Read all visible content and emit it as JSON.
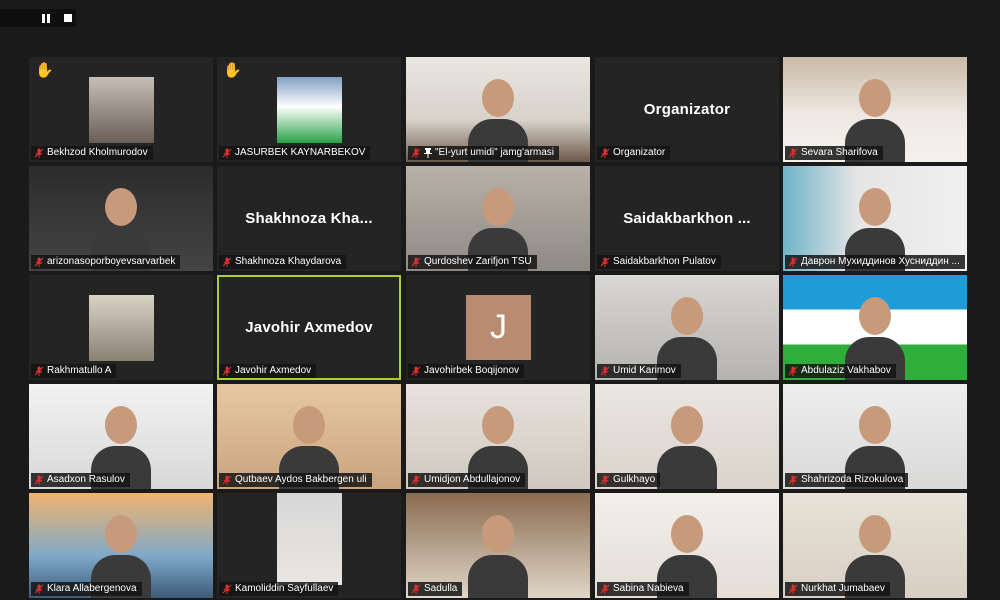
{
  "toolbar": {
    "pause_icon": "pause-icon",
    "stop_icon": "stop-icon"
  },
  "colors": {
    "background": "#1a1a1a",
    "tile": "#242424",
    "active_border": "#a6cf3a",
    "mute_icon": "#e02f2f"
  },
  "participants": [
    {
      "name": "Bekhzod Kholmurodov",
      "hand": true,
      "video": "photo"
    },
    {
      "name": "JASURBEK KAYNARBEKOV",
      "hand": true,
      "video": "photo"
    },
    {
      "name": "\"El-yurt umidi\" jamg'armasi",
      "pinned": true,
      "video": "camera"
    },
    {
      "name": "Organizator",
      "display": "Organizator",
      "video": "off"
    },
    {
      "name": "Sevara Sharifova",
      "video": "camera"
    },
    {
      "name": "arizonasoporboyevsarvarbek",
      "video": "camera"
    },
    {
      "name": "Shakhnoza Khaydarova",
      "display": "Shakhnoza  Kha...",
      "video": "off"
    },
    {
      "name": "Qurdoshev Zarifjon TSU",
      "video": "camera"
    },
    {
      "name": "Saidakbarkhon Pulatov",
      "display": "Saidakbarkhon ...",
      "video": "off"
    },
    {
      "name": "Даврон Мухиддинов Хусниддин ...",
      "video": "camera"
    },
    {
      "name": "Rakhmatullo A",
      "video": "photo"
    },
    {
      "name": "Javohir Axmedov",
      "display": "Javohir Axmedov",
      "active": true,
      "video": "off"
    },
    {
      "name": "Javohirbek Boqijonov",
      "avatar": "J",
      "video": "off"
    },
    {
      "name": "Umid Karimov",
      "video": "camera"
    },
    {
      "name": "Abdulaziz Vakhabov",
      "video": "camera"
    },
    {
      "name": "Asadxon Rasulov",
      "video": "camera"
    },
    {
      "name": "Qutbaev Aydos Bakbergen uli",
      "video": "camera"
    },
    {
      "name": "Umidjon Abdullajonov",
      "video": "camera"
    },
    {
      "name": "Gulkhayo",
      "video": "camera"
    },
    {
      "name": "Shahrizoda Rizokulova",
      "video": "camera"
    },
    {
      "name": "Klara Allabergenova",
      "video": "camera"
    },
    {
      "name": "Kamoliddin Sayfullaev",
      "video": "photo"
    },
    {
      "name": "Sadulla",
      "video": "camera"
    },
    {
      "name": "Sabina Nabieva",
      "video": "camera"
    },
    {
      "name": "Nurkhat Jumabaev",
      "video": "camera"
    }
  ]
}
